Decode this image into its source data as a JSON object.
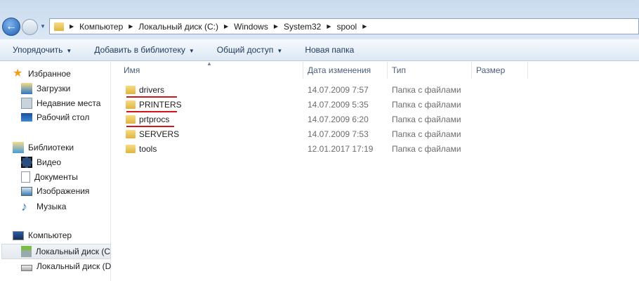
{
  "address": {
    "crumbs": [
      "Компьютер",
      "Локальный диск (C:)",
      "Windows",
      "System32",
      "spool"
    ]
  },
  "toolbar": {
    "organize": "Упорядочить",
    "add_library": "Добавить в библиотеку",
    "share": "Общий доступ",
    "new_folder": "Новая папка"
  },
  "nav": {
    "favorites": "Избранное",
    "downloads": "Загрузки",
    "recent": "Недавние места",
    "desktop": "Рабочий стол",
    "libraries": "Библиотеки",
    "video": "Видео",
    "documents": "Документы",
    "images": "Изображения",
    "music": "Музыка",
    "computer": "Компьютер",
    "disk_c": "Локальный диск (C",
    "disk_d": "Локальный диск (D"
  },
  "columns": {
    "name": "Имя",
    "date": "Дата изменения",
    "type": "Тип",
    "size": "Размер"
  },
  "files": [
    {
      "name": "drivers",
      "date": "14.07.2009 7:57",
      "type": "Папка с файлами",
      "underlined": true
    },
    {
      "name": "PRINTERS",
      "date": "14.07.2009 5:35",
      "type": "Папка с файлами",
      "underlined": true
    },
    {
      "name": "prtprocs",
      "date": "14.07.2009 6:20",
      "type": "Папка с файлами",
      "underlined": true
    },
    {
      "name": "SERVERS",
      "date": "14.07.2009 7:53",
      "type": "Папка с файлами",
      "underlined": false
    },
    {
      "name": "tools",
      "date": "12.01.2017 17:19",
      "type": "Папка с файлами",
      "underlined": false
    }
  ],
  "colors": {
    "underline": "#d3141b"
  }
}
